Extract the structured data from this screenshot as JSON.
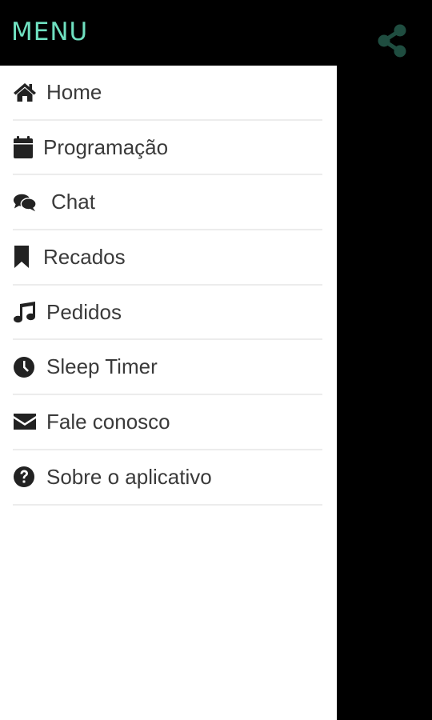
{
  "drawer": {
    "title": "MENU",
    "items": [
      {
        "label": "Home",
        "icon": "home-icon"
      },
      {
        "label": "Programação",
        "icon": "calendar-icon"
      },
      {
        "label": "Chat",
        "icon": "chat-icon"
      },
      {
        "label": "Recados",
        "icon": "bookmark-icon"
      },
      {
        "label": "Pedidos",
        "icon": "music-icon"
      },
      {
        "label": "Sleep Timer",
        "icon": "clock-icon"
      },
      {
        "label": "Fale conosco",
        "icon": "envelope-icon"
      },
      {
        "label": "Sobre o aplicativo",
        "icon": "question-icon"
      }
    ]
  },
  "toolbar": {
    "share_icon": "share-icon"
  },
  "colors": {
    "title": "#6fe0c0",
    "share_icon": "#1f4d40",
    "background": "#000000",
    "drawer": "#ffffff",
    "text": "#3a3a3a",
    "icon": "#222222"
  }
}
